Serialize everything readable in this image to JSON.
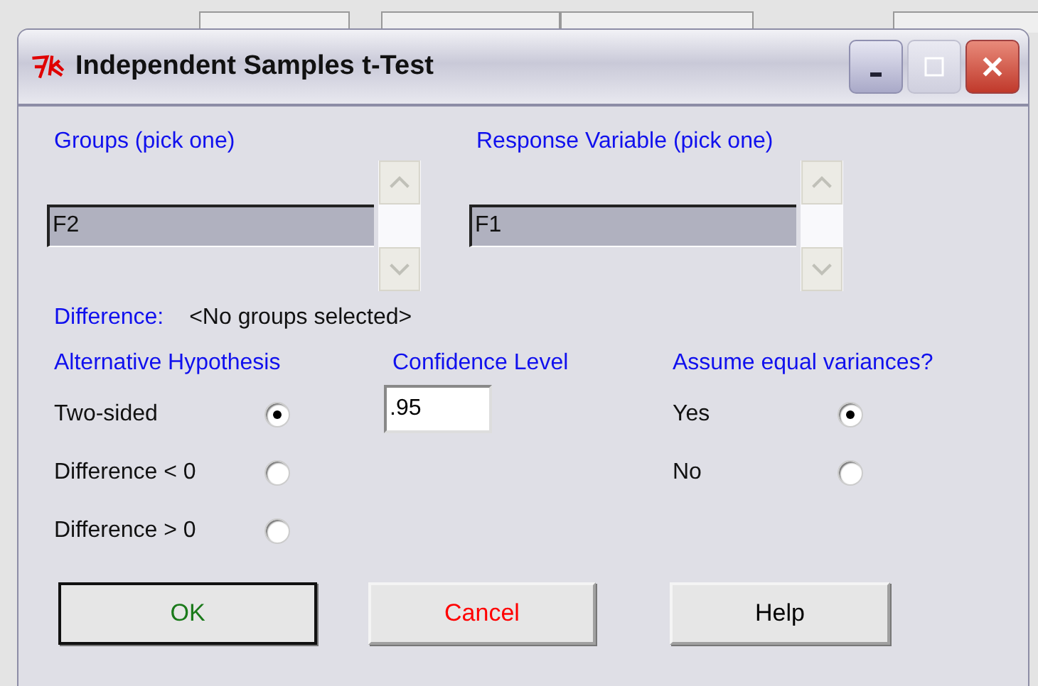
{
  "window": {
    "title": "Independent Samples t-Test"
  },
  "groups": {
    "label": "Groups (pick one)",
    "items": [
      {
        "text": "F2",
        "selected": true
      }
    ]
  },
  "response": {
    "label": "Response Variable (pick one)",
    "items": [
      {
        "text": "F1",
        "selected": true
      }
    ]
  },
  "difference": {
    "label": "Difference:",
    "value": "<No groups selected>"
  },
  "alternative": {
    "label": "Alternative Hypothesis",
    "options": [
      {
        "label": "Two-sided",
        "selected": true
      },
      {
        "label": "Difference < 0",
        "selected": false
      },
      {
        "label": "Difference > 0",
        "selected": false
      }
    ]
  },
  "confidence": {
    "label": "Confidence Level",
    "value": ".95"
  },
  "variances": {
    "label": "Assume equal variances?",
    "options": [
      {
        "label": "Yes",
        "selected": true
      },
      {
        "label": "No",
        "selected": false
      }
    ]
  },
  "buttons": [
    {
      "label": "OK",
      "color": "#1a7a1a",
      "default": true
    },
    {
      "label": "Cancel",
      "color": "#ff0000",
      "default": false
    },
    {
      "label": "Help",
      "color": "#000000",
      "default": false
    }
  ]
}
